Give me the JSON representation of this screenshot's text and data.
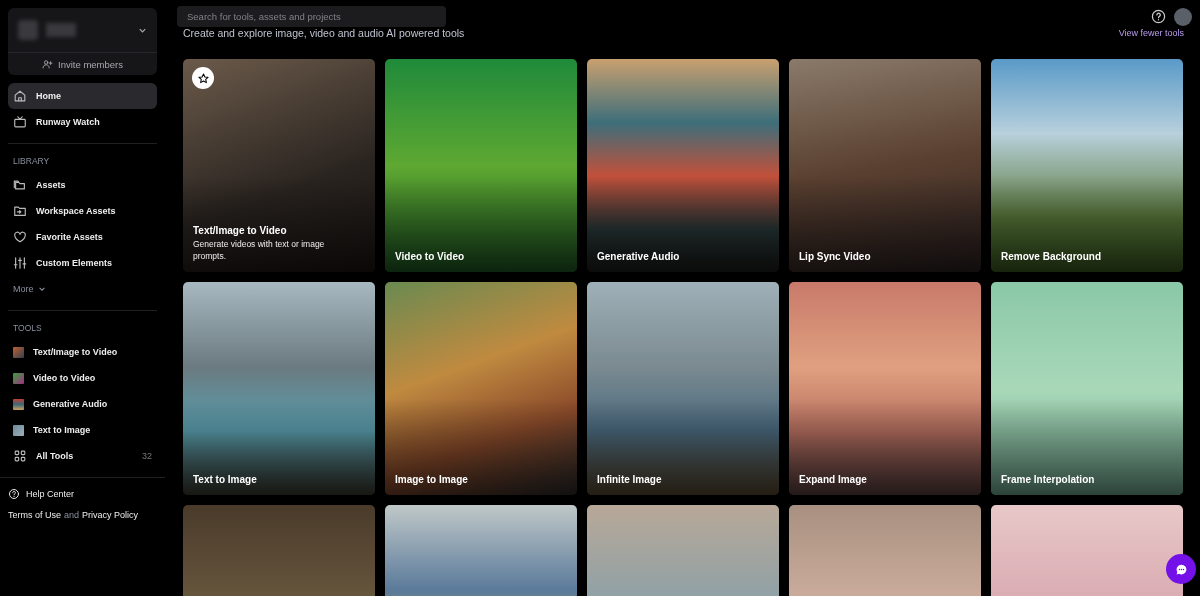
{
  "workspace": {
    "invite_label": "Invite members"
  },
  "nav": [
    {
      "label": "Home",
      "kind": "home",
      "selected": true
    },
    {
      "label": "Runway Watch",
      "kind": "tv",
      "selected": false
    }
  ],
  "library": {
    "heading": "LIBRARY",
    "items": [
      {
        "label": "Assets",
        "kind": "folders"
      },
      {
        "label": "Workspace Assets",
        "kind": "folder"
      },
      {
        "label": "Favorite Assets",
        "kind": "heart"
      },
      {
        "label": "Custom Elements",
        "kind": "sliders"
      }
    ],
    "more": "More"
  },
  "tools": {
    "heading": "TOOLS",
    "items": [
      {
        "label": "Text/Image to Video",
        "kind": "tool"
      },
      {
        "label": "Video to Video",
        "kind": "tool"
      },
      {
        "label": "Generative Audio",
        "kind": "tool"
      },
      {
        "label": "Text to Image",
        "kind": "tool"
      },
      {
        "label": "All Tools",
        "kind": "all",
        "count": "32"
      }
    ]
  },
  "help": "Help Center",
  "legal": {
    "terms": "Terms of Use",
    "joiner": "and",
    "privacy": "Privacy Policy"
  },
  "search": {
    "placeholder": "Search for tools, assets and projects"
  },
  "subtitle": "Create and explore image, video and audio AI powered tools",
  "view_fewer": "View fewer tools",
  "cards": [
    {
      "kind": "featured",
      "title": "Text/Image to Video",
      "description": "Generate videos with text or image prompts."
    },
    {
      "kind": "plain",
      "title": "Video to Video"
    },
    {
      "kind": "plain",
      "title": "Generative Audio"
    },
    {
      "kind": "plain",
      "title": "Lip Sync Video"
    },
    {
      "kind": "plain",
      "title": "Remove Background"
    },
    {
      "kind": "plain",
      "title": "Text to Image"
    },
    {
      "kind": "plain",
      "title": "Image to Image"
    },
    {
      "kind": "plain",
      "title": "Infinite Image"
    },
    {
      "kind": "plain",
      "title": "Expand Image"
    },
    {
      "kind": "plain",
      "title": "Frame Interpolation"
    },
    {
      "kind": "plain"
    },
    {
      "kind": "plain"
    },
    {
      "kind": "plain"
    },
    {
      "kind": "plain"
    },
    {
      "kind": "plain"
    }
  ]
}
